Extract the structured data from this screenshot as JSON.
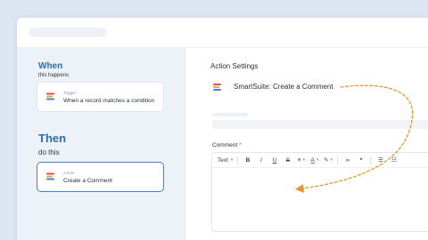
{
  "left": {
    "when_title": "When",
    "when_sub": "this happens",
    "trigger_card": {
      "kicker": "Trigger",
      "text": "When a record matches a condition"
    },
    "then_title": "Then",
    "then_sub": "do this",
    "action_card": {
      "kicker": "Action",
      "text": "Create a Comment"
    }
  },
  "right": {
    "settings_title": "Action Settings",
    "app_row_label": "SmartSuite: Create a Comment",
    "comment_label": "Comment",
    "required_mark": "*",
    "toolbar": {
      "text_style": "Text",
      "text_style_chevron": "▾",
      "bold": "B",
      "italic": "I",
      "underline": "U",
      "strike": "S",
      "align": "≡",
      "align_chevron": "▾",
      "font_color": "A",
      "font_color_chevron": "▾",
      "highlight": "✎",
      "highlight_chevron": "▾",
      "link": "∞",
      "quote": "❝",
      "checklist": "☰",
      "bullets": "☷"
    }
  },
  "colors": {
    "accent_blue": "#2b6cb0",
    "arrow_orange": "#e8962e",
    "logo_stripes": [
      "#e5484d",
      "#f5a623",
      "#3b82f6"
    ]
  }
}
